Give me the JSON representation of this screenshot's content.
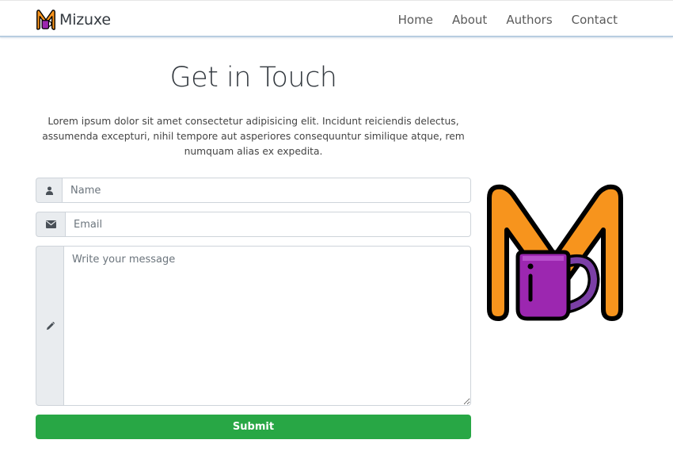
{
  "brand": {
    "name": "Mizuxe"
  },
  "nav": {
    "items": [
      "Home",
      "About",
      "Authors",
      "Contact"
    ]
  },
  "contact": {
    "title": "Get in Touch",
    "lead": "Lorem ipsum dolor sit amet consectetur adipisicing elit. Incidunt reiciendis delectus, assumenda excepturi, nihil tempore aut asperiores consequuntur similique atque, rem numquam alias ex expedita.",
    "name_placeholder": "Name",
    "email_placeholder": "Email",
    "message_placeholder": "Write your message",
    "submit_label": "Submit"
  },
  "icons": {
    "name": "user-icon",
    "email": "envelope-icon",
    "message": "pencil-icon"
  },
  "colors": {
    "accent": "#28a745",
    "logo_orange": "#f7941d",
    "logo_purple": "#9c27b0",
    "logo_outline": "#000000"
  }
}
